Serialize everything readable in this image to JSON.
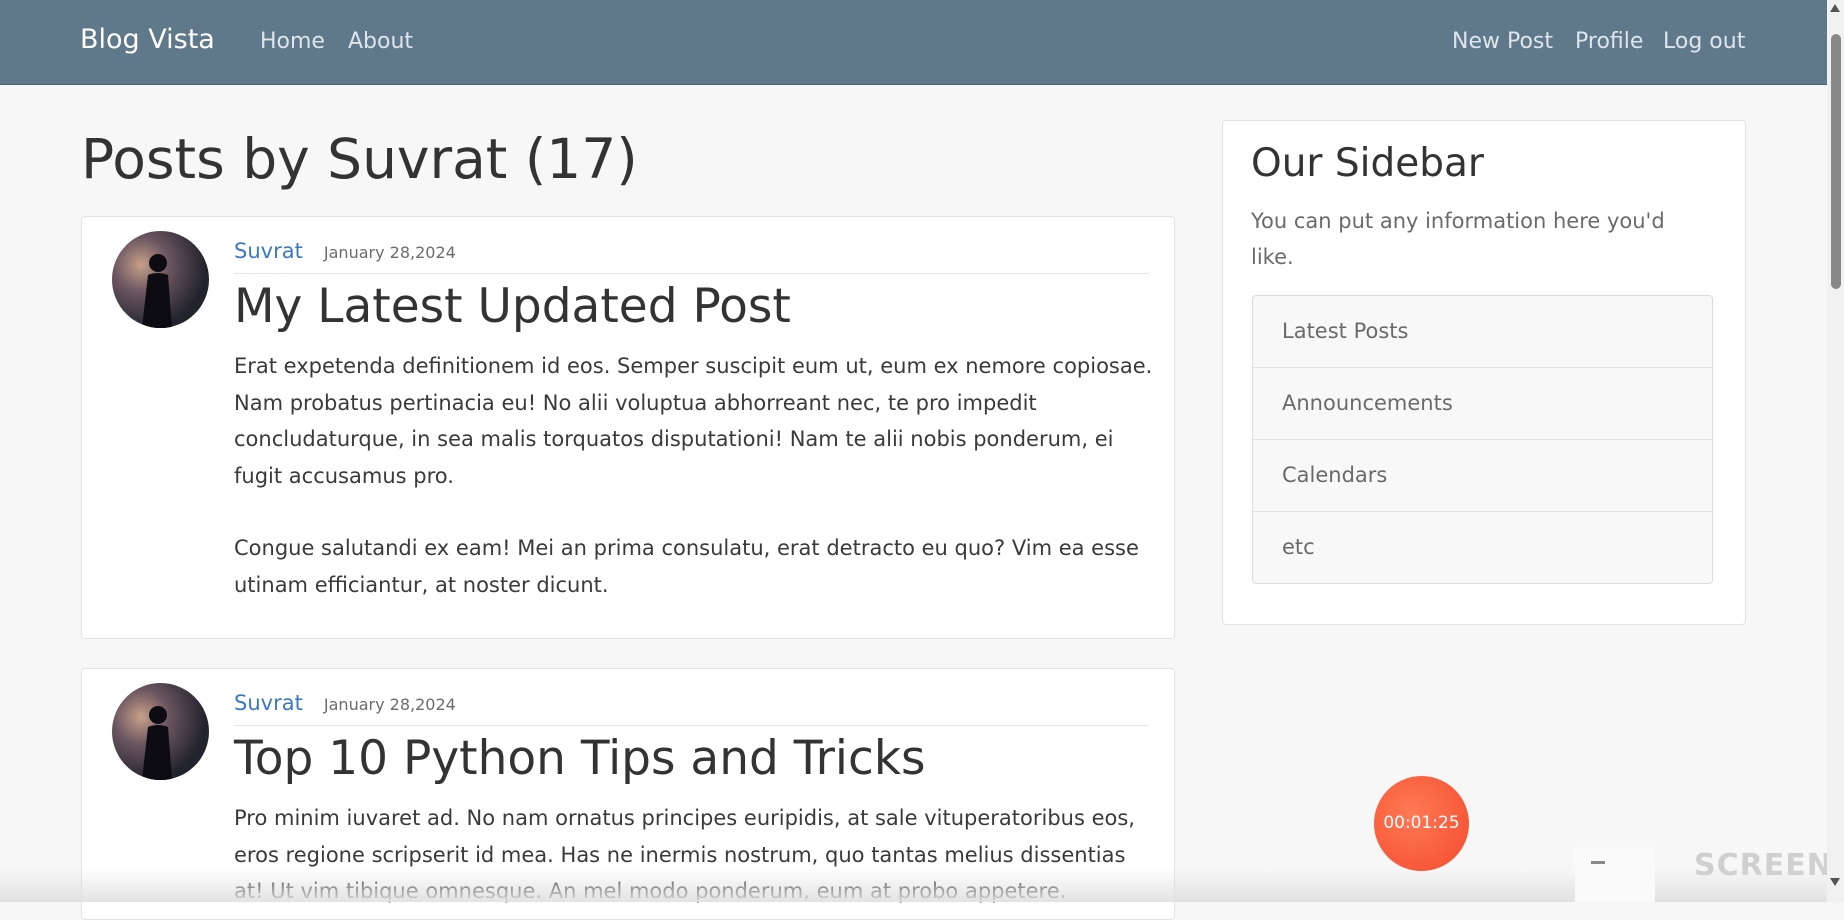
{
  "navbar": {
    "brand": "Blog Vista",
    "left_links": [
      "Home",
      "About"
    ],
    "right_links": [
      "New Post",
      "Profile",
      "Log out"
    ],
    "background": "#5f788a"
  },
  "main": {
    "page_title": "Posts by Suvrat (17)",
    "posts": [
      {
        "author": "Suvrat",
        "date": "January 28,2024",
        "title": "My Latest Updated Post",
        "paragraphs": [
          "Erat expetenda definitionem id eos. Semper suscipit eum ut, eum ex nemore copiosae. Nam probatus pertinacia eu! No alii voluptua abhorreant nec, te pro impedit concludaturque, in sea malis torquatos disputationi! Nam te alii nobis ponderum, ei fugit accusamus pro.",
          "Congue salutandi ex eam! Mei an prima consulatu, erat detracto eu quo? Vim ea esse utinam efficiantur, at noster dicunt."
        ]
      },
      {
        "author": "Suvrat",
        "date": "January 28,2024",
        "title": "Top 10 Python Tips and Tricks",
        "paragraphs": [
          "Pro minim iuvaret ad. No nam ornatus principes euripidis, at sale vituperatoribus eos, eros regione scripserit id mea. Has ne inermis nostrum, quo tantas melius dissentias at! Ut vim tibique omnesque. An mel modo ponderum, eum at probo appetere."
        ]
      }
    ],
    "author_color": "#3a78c2"
  },
  "sidebar": {
    "title": "Our Sidebar",
    "description": "You can put any information here you'd like.",
    "items": [
      "Latest Posts",
      "Announcements",
      "Calendars",
      "etc"
    ]
  },
  "overlay": {
    "timer": "00:01:25",
    "timer_color": "#f24a2c",
    "watermark": "SCREEN"
  }
}
